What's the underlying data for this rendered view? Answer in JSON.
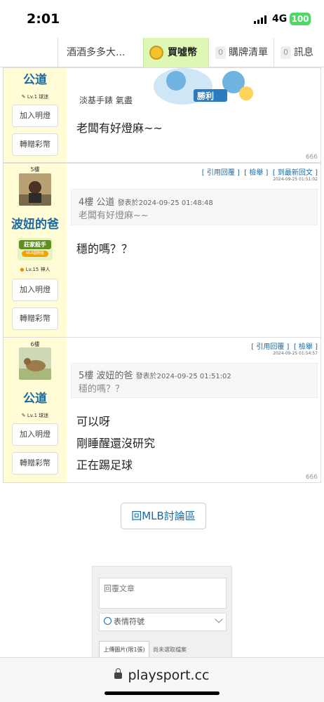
{
  "status": {
    "time": "2:01",
    "network": "4G",
    "battery": "100"
  },
  "tabs": {
    "thread": "酒酒多多大...",
    "buy": "買噓幣",
    "cart": {
      "count": "0",
      "label": "購牌清單"
    },
    "messages": {
      "count": "0",
      "label": "訊息"
    }
  },
  "posts": [
    {
      "username": "公道",
      "level": "Lv.1 球迷",
      "add_light": "加入明燈",
      "gift": "轉贈彩幣",
      "partial_text": "淡基手錶 氣盡",
      "banner_text": "勝利",
      "message": "老闆有好燈麻~~",
      "views": "666"
    },
    {
      "floor": "5樓",
      "username": "波妞的爸",
      "badge_title": "莊家殺手",
      "badge_sub": "MLB國際盤",
      "level": "Lv.15 神人",
      "add_light": "加入明燈",
      "gift": "轉贈彩幣",
      "actions": [
        "[ 引用回覆 ]",
        "[ 檢舉 ]",
        "[ 到最新回文 ]"
      ],
      "timestamp": "2024-09-25 01:51:02",
      "quote": {
        "floor": "4樓",
        "user": "公道",
        "posted": "發表於2024-09-25 01:48:48",
        "text": "老闆有好燈麻~~"
      },
      "message": "穩的嗎？？"
    },
    {
      "floor": "6樓",
      "username": "公道",
      "level": "Lv.1 球迷",
      "add_light": "加入明燈",
      "gift": "轉贈彩幣",
      "actions": [
        "[ 引用回覆 ]",
        "[ 檢舉 ]"
      ],
      "timestamp": "2024-09-25 01:54:57",
      "quote": {
        "floor": "5樓",
        "user": "波妞的爸",
        "posted": "發表於2024-09-25 01:51:02",
        "text": "穩的嗎？？"
      },
      "lines": [
        "可以呀",
        "剛睡醒還沒研究",
        "正在踢足球"
      ],
      "views": "666"
    }
  ],
  "back_button": "回MLB討論區",
  "reply": {
    "placeholder": "回覆文章",
    "emoji": "表情符號",
    "upload": "上傳圖片(限1張)",
    "no_file": "尚未選取檔案"
  },
  "url": "playsport.cc",
  "colors": {
    "accent": "#1b69a5",
    "sidebar": "#fffcd6",
    "buy_tab": "#dff7b5",
    "battery": "#4cd964"
  }
}
